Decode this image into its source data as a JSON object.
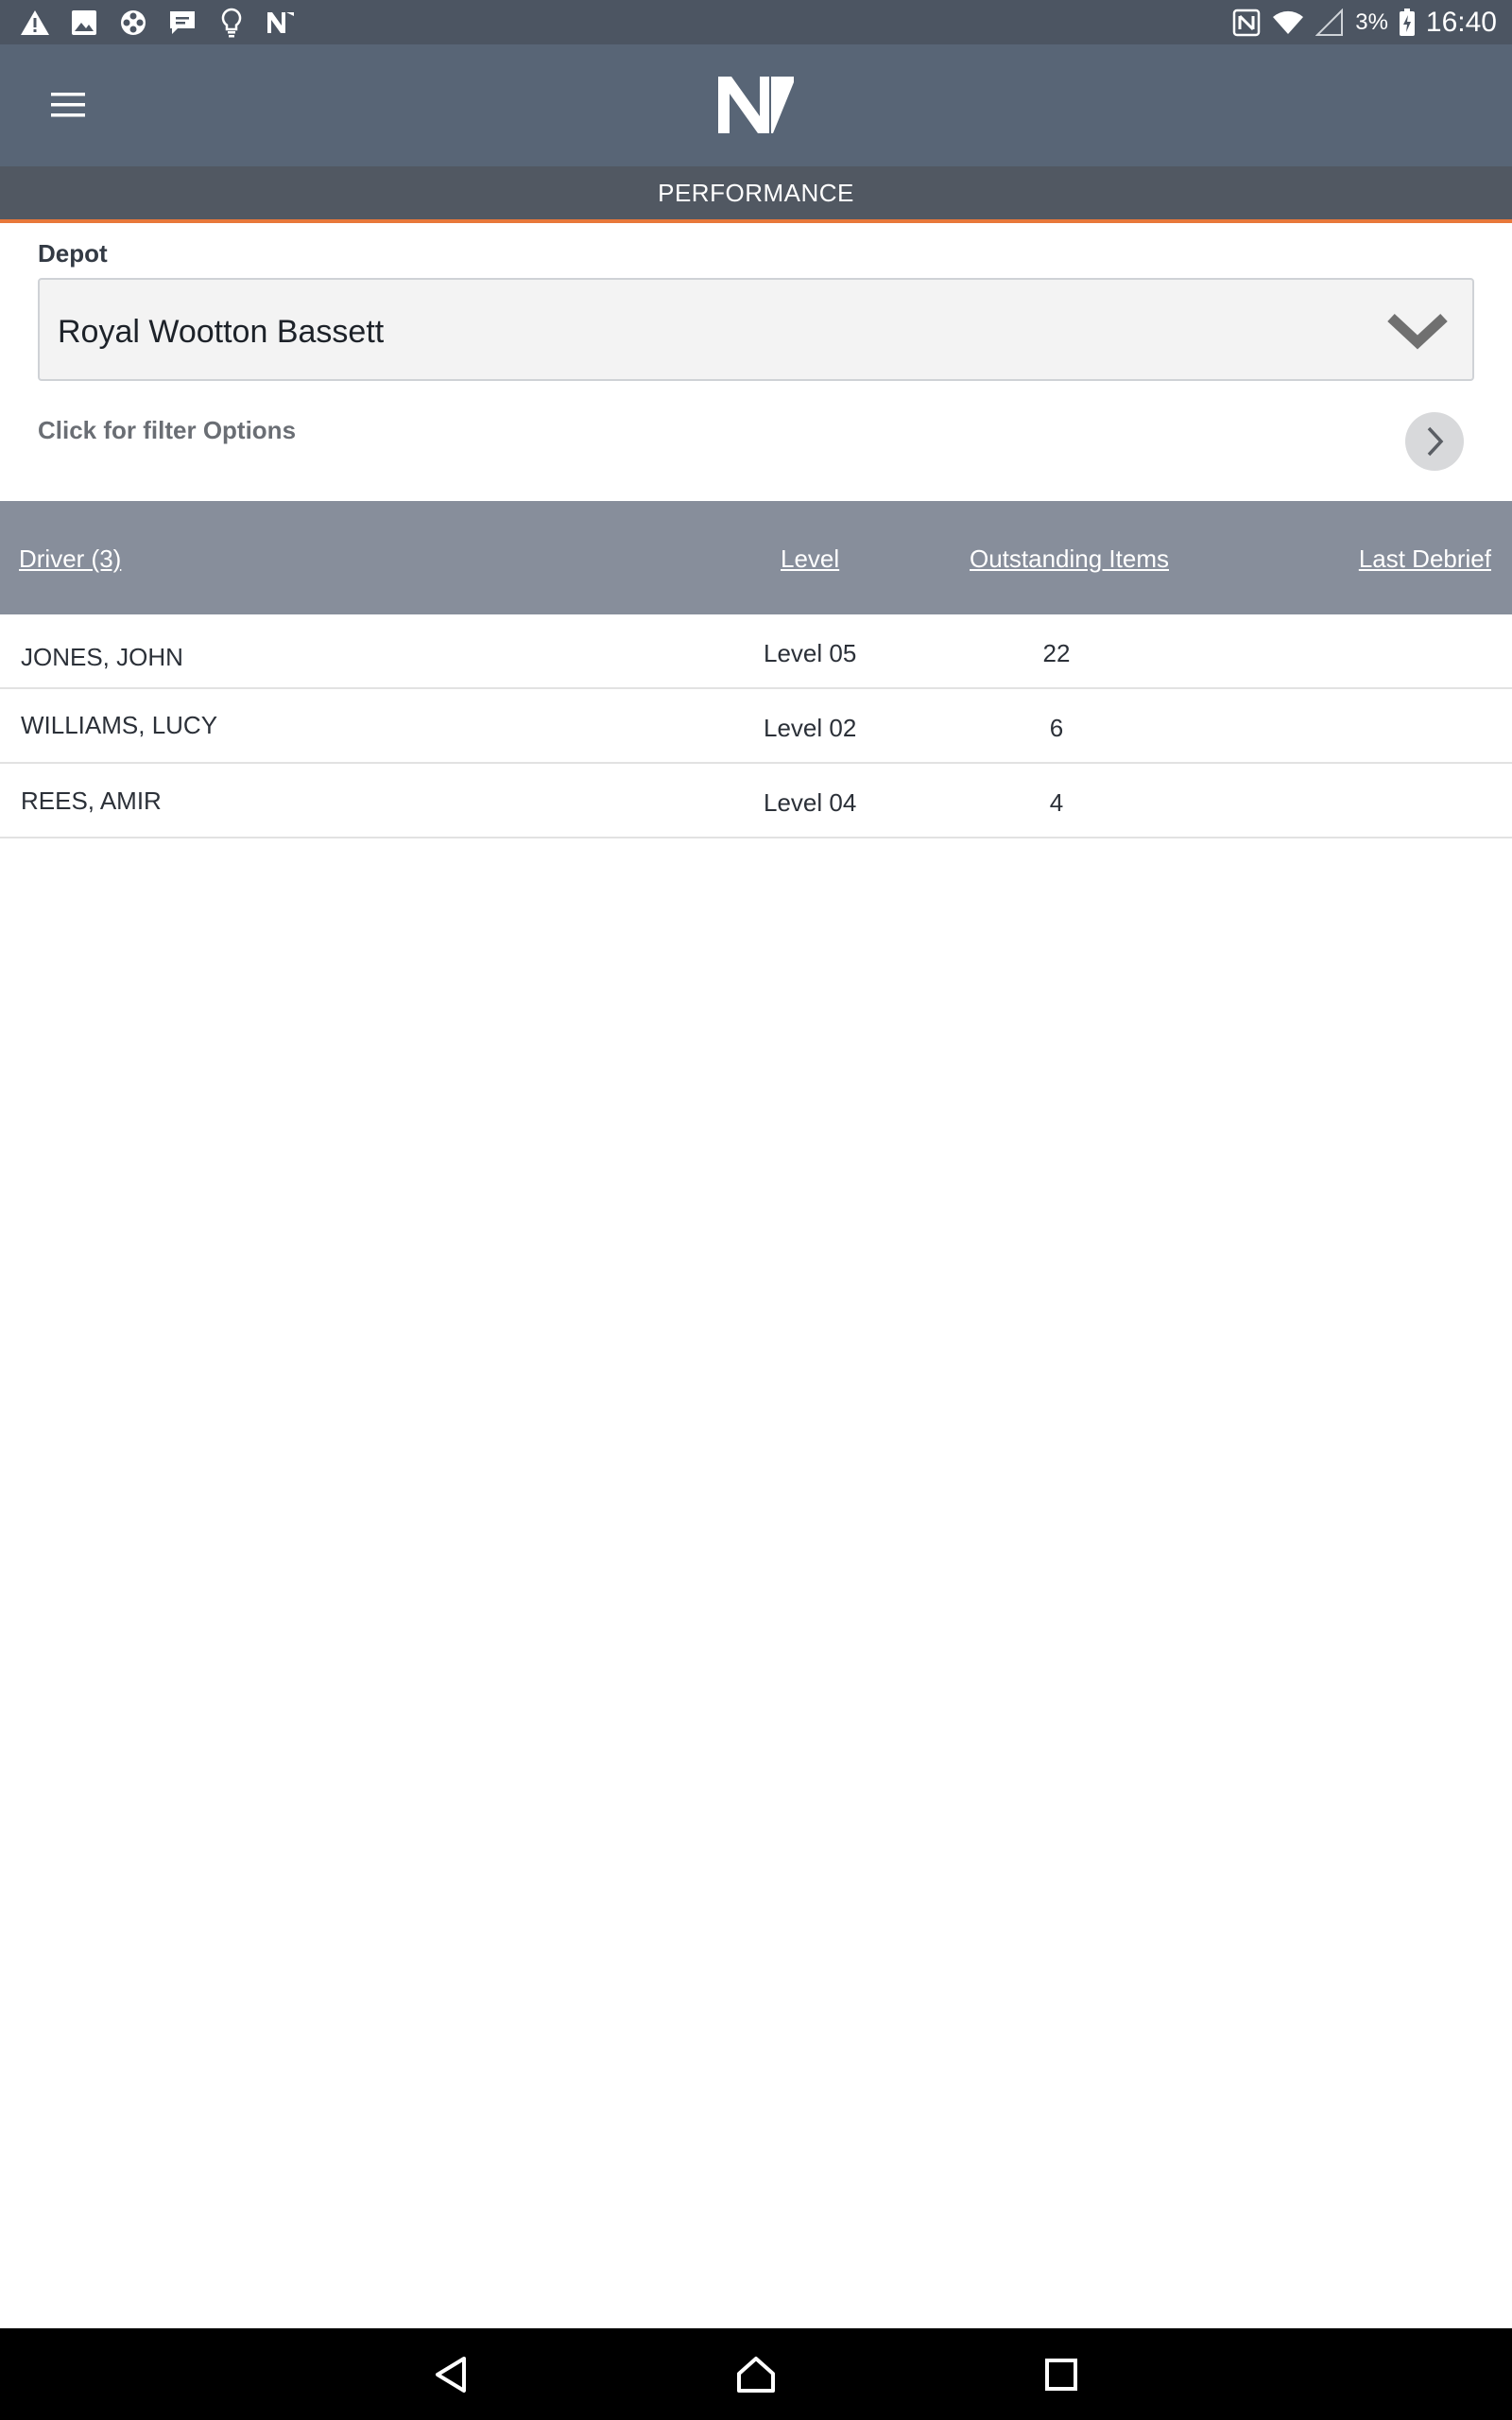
{
  "status_bar": {
    "left_icons": [
      "warning-icon",
      "image-icon",
      "film-reel-icon",
      "message-icon",
      "lightbulb-icon",
      "app-logo-icon"
    ],
    "right_icons": [
      "nfc-icon",
      "wifi-icon",
      "signal-icon",
      "battery-charging-icon"
    ],
    "battery_percent": "3%",
    "time": "16:40"
  },
  "header": {
    "menu_icon": "hamburger-menu-icon",
    "logo_icon": "brand-logo-icon",
    "page_title": "PERFORMANCE",
    "accent_color": "#e8783a"
  },
  "depot": {
    "label": "Depot",
    "selected": "Royal Wootton Bassett",
    "chevron_icon": "chevron-down-icon"
  },
  "filter": {
    "label": "Click for filter Options",
    "arrow_icon": "chevron-right-icon"
  },
  "table": {
    "headers": {
      "driver": "Driver (3)",
      "level": "Level",
      "outstanding": "Outstanding Items",
      "last_debrief": "Last Debrief"
    },
    "rows": [
      {
        "driver": "JONES, JOHN",
        "level": "Level 05",
        "outstanding": "22",
        "last_debrief": ""
      },
      {
        "driver": "WILLIAMS, LUCY",
        "level": "Level 02",
        "outstanding": "6",
        "last_debrief": ""
      },
      {
        "driver": "REES, AMIR",
        "level": "Level 04",
        "outstanding": "4",
        "last_debrief": ""
      }
    ]
  },
  "nav_bar": {
    "back_icon": "back-triangle-icon",
    "home_icon": "home-icon",
    "recents_icon": "recents-square-icon"
  }
}
